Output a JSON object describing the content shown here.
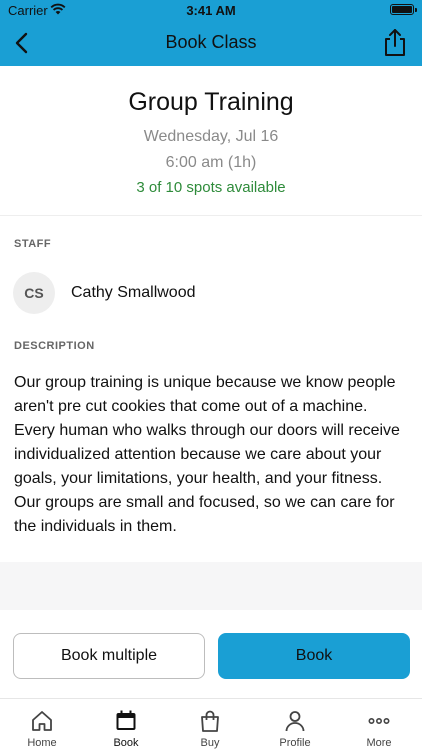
{
  "status_bar": {
    "carrier": "Carrier",
    "time": "3:41 AM"
  },
  "nav": {
    "title": "Book Class",
    "back_icon": "chevron-left-icon",
    "share_icon": "share-icon"
  },
  "class_info": {
    "name": "Group Training",
    "date": "Wednesday, Jul 16",
    "time": "6:00 am (1h)",
    "availability": "3 of 10 spots available"
  },
  "staff": {
    "section_label": "STAFF",
    "initials": "CS",
    "name": "Cathy Smallwood"
  },
  "description": {
    "section_label": "DESCRIPTION",
    "text": "Our group training is unique because we know people aren't pre cut cookies that come out of a machine. Every human who walks through our doors will receive individualized attention because we care about your goals, your limitations, your health, and your fitness. Our groups are small and focused, so we can care for the individuals in them."
  },
  "actions": {
    "book_multiple_label": "Book multiple",
    "book_label": "Book"
  },
  "tabs": [
    {
      "label": "Home",
      "icon": "home-icon"
    },
    {
      "label": "Book",
      "icon": "calendar-icon",
      "selected": true
    },
    {
      "label": "Buy",
      "icon": "shopping-bag-icon"
    },
    {
      "label": "Profile",
      "icon": "person-icon"
    },
    {
      "label": "More",
      "icon": "ellipsis-icon"
    }
  ],
  "colors": {
    "accent": "#1a9fd4",
    "availability_green": "#2e8b3a",
    "muted_text": "#8a8a8a"
  }
}
